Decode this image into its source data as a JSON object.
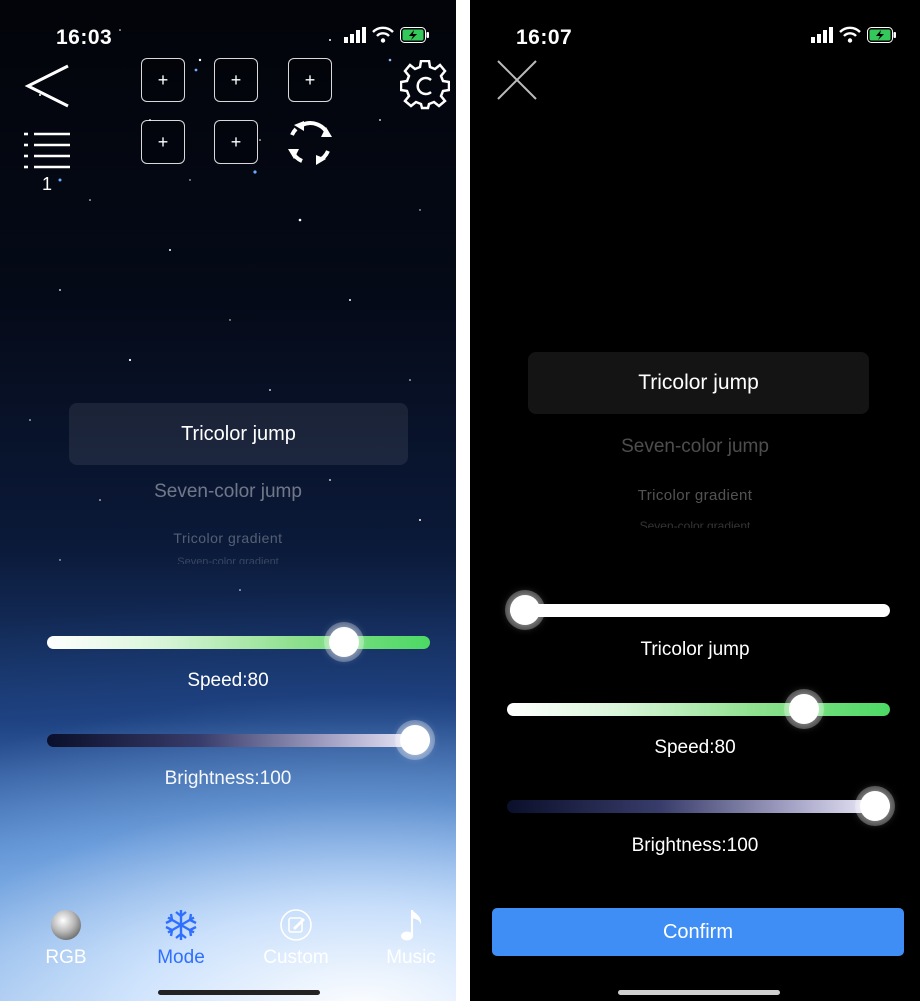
{
  "left": {
    "status": {
      "time": "16:03"
    },
    "header": {
      "preset_buttons": [
        "+",
        "+",
        "+",
        "+",
        "+"
      ],
      "list_count": "1"
    },
    "picker": {
      "selected": "Tricolor jump",
      "items": [
        "Seven-color jump",
        "Tricolor gradient",
        "Seven-color gradient"
      ]
    },
    "sliders": {
      "speed": {
        "label": "Speed:80",
        "value": 80
      },
      "brightness": {
        "label": "Brightness:100",
        "value": 100
      }
    },
    "tabs": [
      {
        "label": "RGB",
        "icon": "rgb-disc-icon"
      },
      {
        "label": "Mode",
        "icon": "snowflake-icon",
        "active": true
      },
      {
        "label": "Custom",
        "icon": "edit-circle-icon"
      },
      {
        "label": "Music",
        "icon": "music-note-icon"
      }
    ],
    "active_color": "#2f6fff"
  },
  "right": {
    "status": {
      "time": "16:07"
    },
    "picker": {
      "selected": "Tricolor jump",
      "items": [
        "Seven-color jump",
        "Tricolor gradient",
        "Seven-color gradient"
      ]
    },
    "sliders": {
      "mode": {
        "label": "Tricolor jump",
        "value": 0
      },
      "speed": {
        "label": "Speed:80",
        "value": 80
      },
      "brightness": {
        "label": "Brightness:100",
        "value": 100
      }
    },
    "confirm_label": "Confirm",
    "confirm_color": "#3f8ef5"
  }
}
